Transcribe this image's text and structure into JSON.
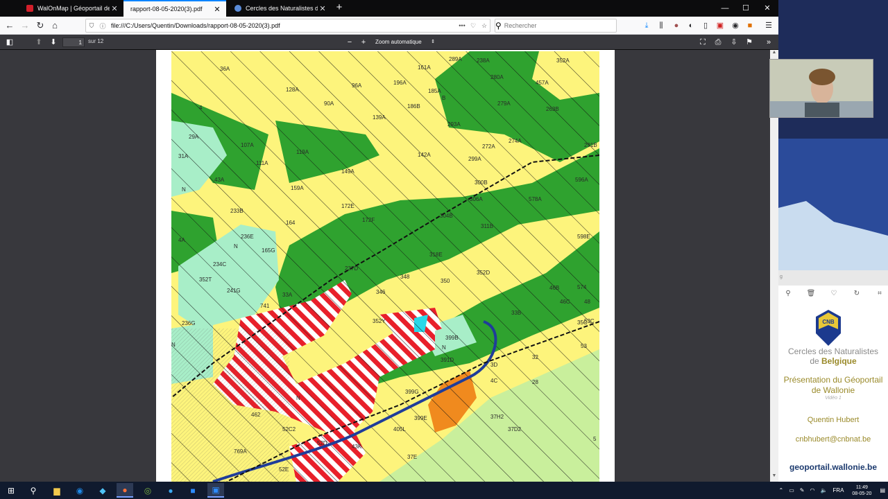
{
  "tabs": [
    {
      "title": "WalOnMap | Géoportail de la W",
      "active": false
    },
    {
      "title": "rapport-08-05-2020(3).pdf",
      "active": true
    },
    {
      "title": "Cercles des Naturalistes de Be",
      "active": false
    }
  ],
  "navbar": {
    "url": "file:///C:/Users/Quentin/Downloads/rapport-08-05-2020(3).pdf",
    "search_placeholder": "Rechercher"
  },
  "pdf_toolbar": {
    "page_number": "1",
    "page_count": "sur 12",
    "zoom": "Zoom automatique"
  },
  "map": {
    "labels": [
      "36A",
      "128A",
      "96A",
      "161A",
      "238A",
      "289A",
      "280A",
      "352A",
      "457A",
      "196A",
      "185A",
      "90A",
      "186B",
      "279A",
      "263B",
      "139A",
      "293A",
      "29A",
      "107A",
      "119A",
      "142A",
      "272A",
      "274A",
      "291B",
      "31A",
      "111A",
      "299A",
      "43A",
      "149A",
      "300B",
      "596A",
      "159A",
      "306A",
      "578A",
      "233B",
      "172E",
      "304B",
      "164",
      "172F",
      "311B",
      "236E",
      "165G",
      "598E",
      "318E",
      "234C",
      "237D",
      "348",
      "350",
      "352D",
      "352T",
      "241G",
      "741",
      "33A",
      "346",
      "46B",
      "46C",
      "574",
      "35C",
      "33B",
      "48",
      "236G",
      "352Y",
      "399B",
      "391D",
      "3D",
      "32",
      "53",
      "28",
      "4C",
      "399G",
      "399E",
      "37H2",
      "37D2",
      "52C2",
      "405L",
      "52D",
      "43K",
      "769A",
      "462",
      "37E",
      "52E",
      "5",
      "53C",
      "4",
      "4A",
      "N",
      "N",
      "N",
      "N",
      "N",
      "B"
    ]
  },
  "side_panel": {
    "strip_text": "g",
    "org_name_line1": "Cercles des Naturalistes",
    "org_name_line2": "de ",
    "org_name_bold": "Belgique",
    "logo_text": "CNB",
    "presentation_title": "Présentation du Géoportail de Wallonie",
    "presentation_sub": "Vidéo 1",
    "author": "Quentin Hubert",
    "email": "cnbhubert@cnbnat.be",
    "website": "geoportail.wallonie.be"
  },
  "taskbar": {
    "language": "FRA",
    "time": "11:49",
    "date": "08-05-20"
  },
  "colors": {
    "map_yellow": "#fdf47c",
    "map_green": "#2fa22f",
    "map_light_green": "#c9ef9c",
    "map_mint": "#a8eec8",
    "map_red": "#e8202a",
    "map_orange": "#f08a1e",
    "accent": "#0a84ff"
  }
}
